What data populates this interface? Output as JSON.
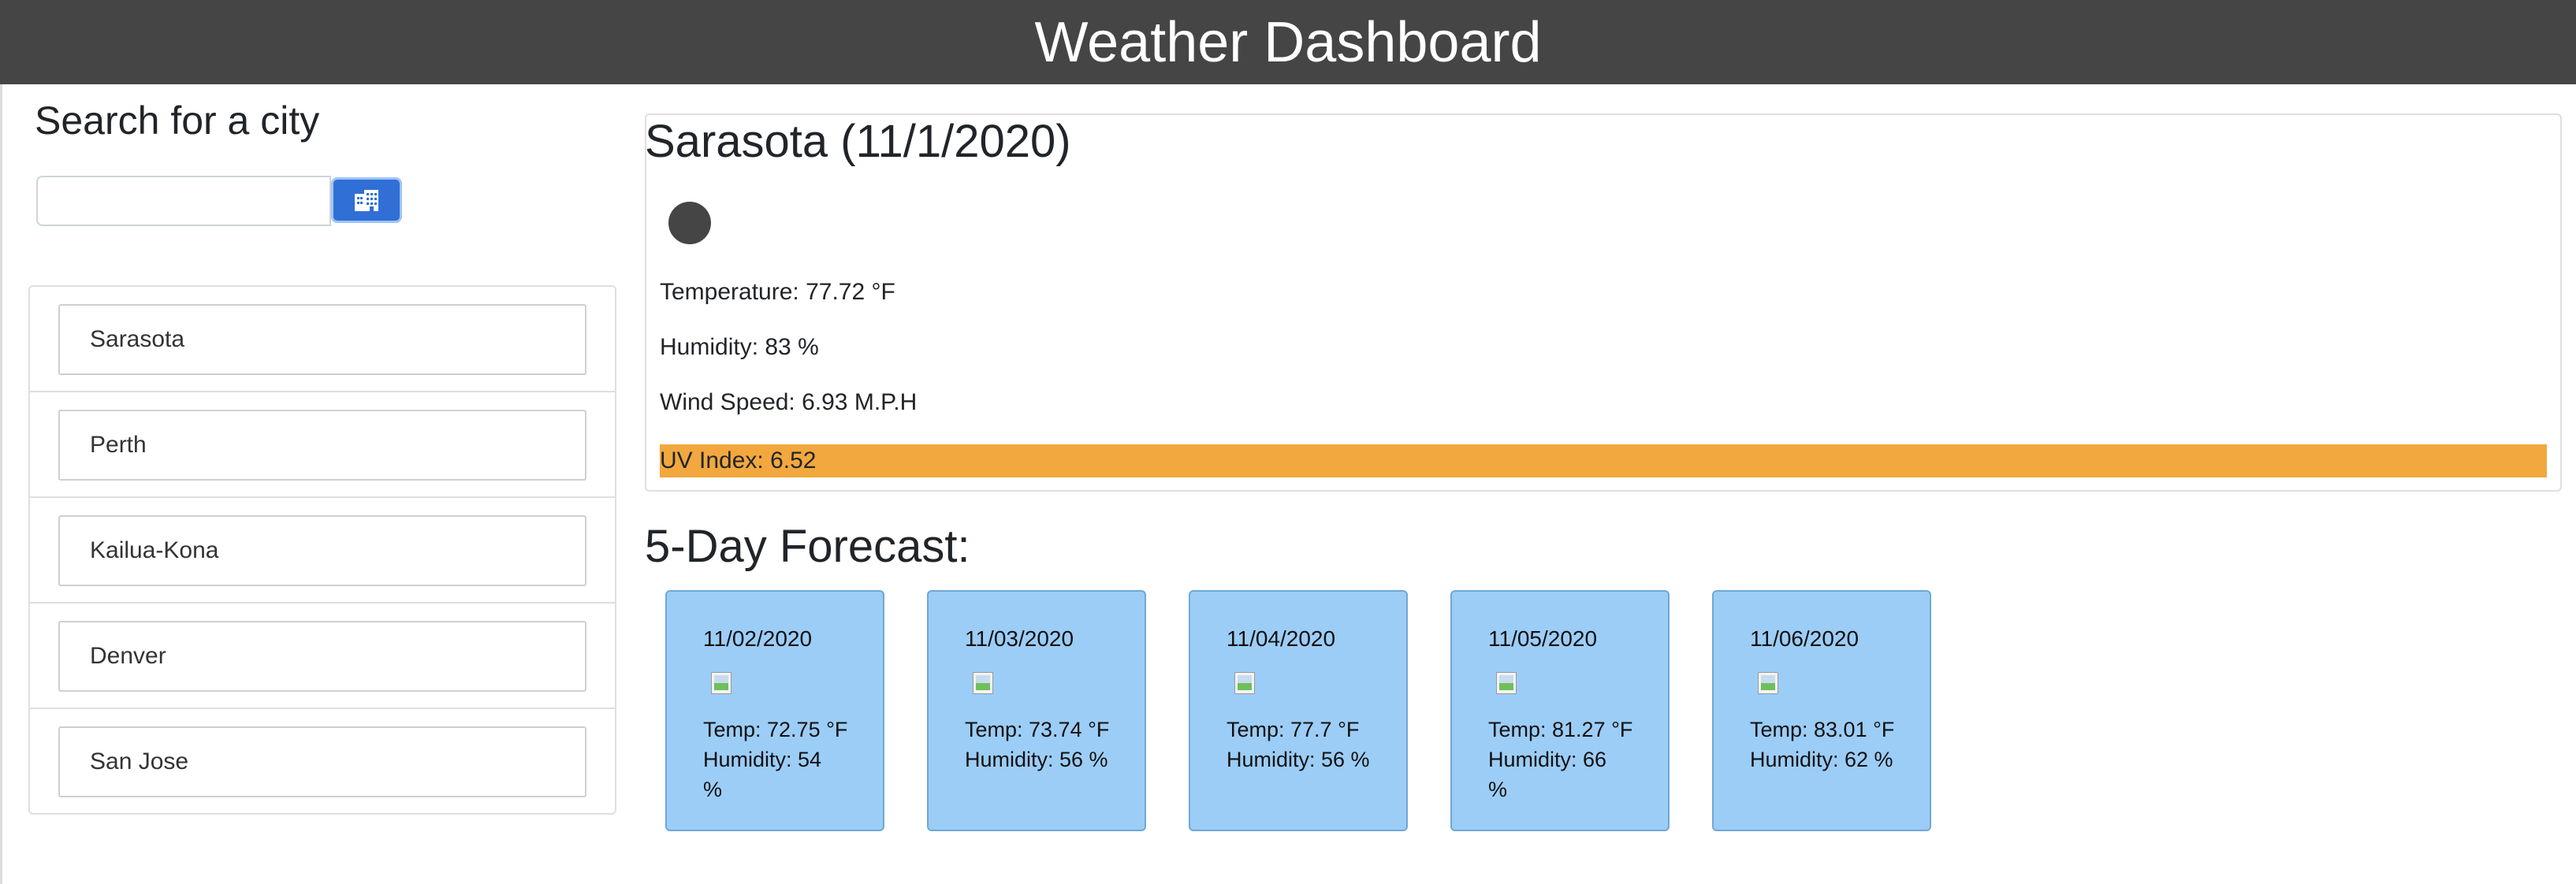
{
  "header": {
    "title": "Weather Dashboard"
  },
  "search": {
    "title": "Search for a city",
    "value": "",
    "button_icon": "city-buildings-icon"
  },
  "history": [
    {
      "label": "Sarasota"
    },
    {
      "label": "Perth"
    },
    {
      "label": "Kailua-Kona"
    },
    {
      "label": "Denver"
    },
    {
      "label": "San Jose"
    }
  ],
  "current": {
    "title": "Sarasota (11/1/2020)",
    "icon": "weather-icon",
    "temperature": "Temperature: 77.72 °F",
    "humidity": "Humidity: 83 %",
    "wind": "Wind Speed: 6.93 M.P.H",
    "uv": "UV Index: 6.52"
  },
  "forecast": {
    "title": "5-Day Forecast:",
    "days": [
      {
        "date": "11/02/2020",
        "temp": "Temp: 72.75 °F",
        "humidity": "Humidity: 54 %"
      },
      {
        "date": "11/03/2020",
        "temp": "Temp: 73.74 °F",
        "humidity": "Humidity: 56 %"
      },
      {
        "date": "11/04/2020",
        "temp": "Temp: 77.7 °F",
        "humidity": "Humidity: 56 %"
      },
      {
        "date": "11/05/2020",
        "temp": "Temp: 81.27 °F",
        "humidity": "Humidity: 66 %"
      },
      {
        "date": "11/06/2020",
        "temp": "Temp: 83.01 °F",
        "humidity": "Humidity: 62 %"
      }
    ]
  },
  "colors": {
    "header_bg": "#454545",
    "button_bg": "#2f6fd6",
    "uv_bg": "#f2a83e",
    "forecast_card_bg": "#9ccdf6"
  }
}
